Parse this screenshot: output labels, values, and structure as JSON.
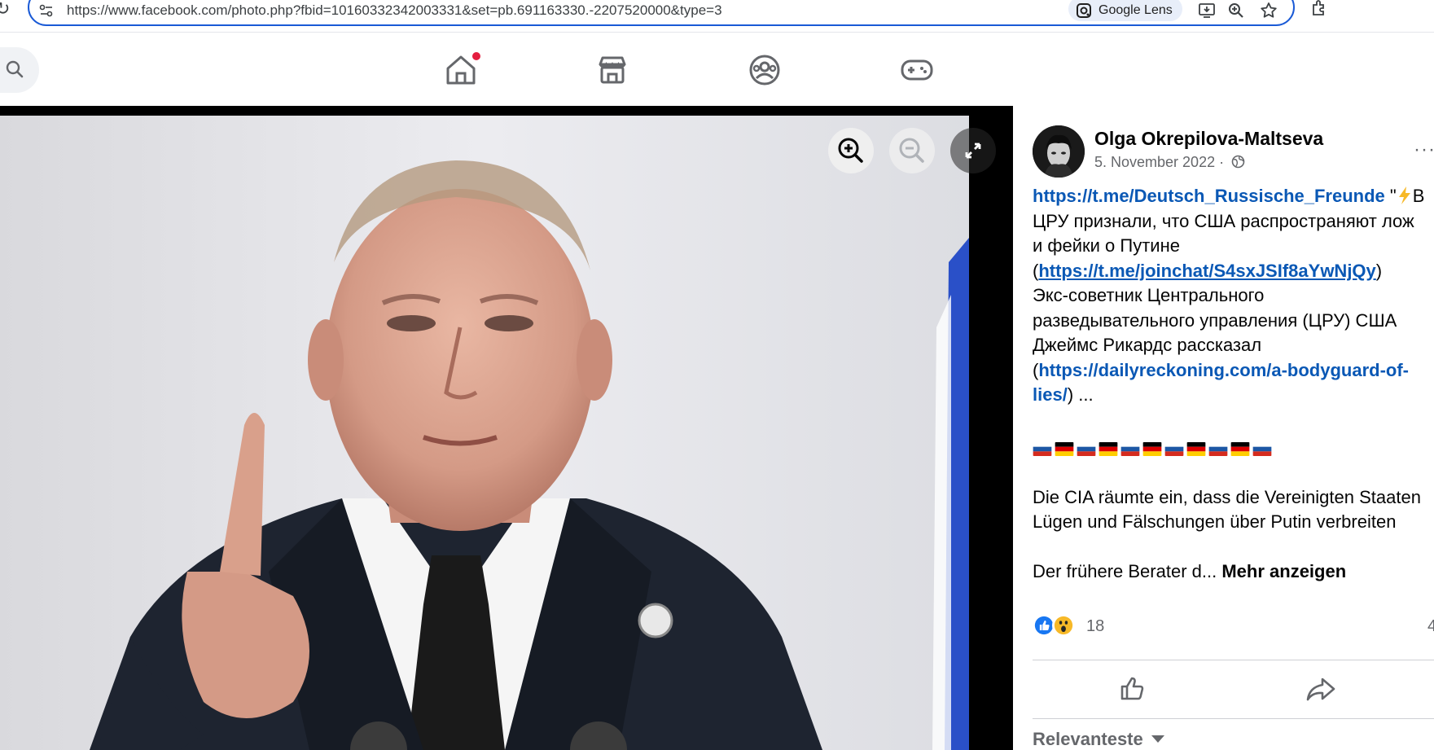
{
  "browser": {
    "url": "https://www.facebook.com/photo.php?fbid=10160332342003331&set=pb.691163330.-2207520000&type=3",
    "lens_label": "Google Lens",
    "icons": [
      "reload-icon",
      "site-info-icon",
      "google-lens-icon",
      "install-app-icon",
      "zoom-icon",
      "bookmark-star-icon",
      "extension-icon"
    ]
  },
  "fb_nav": {
    "icons": [
      "search-icon",
      "home-icon",
      "marketplace-icon",
      "groups-icon",
      "gaming-icon"
    ],
    "accent": "#1877f2",
    "notification_dot_color": "#e41e3f"
  },
  "viewer": {
    "controls": [
      "zoom-in-icon",
      "zoom-out-icon",
      "fullscreen-icon"
    ]
  },
  "post": {
    "author": "Olga Okrepilova-Maltseva",
    "date": "5. November 2022",
    "date_separator": " · ",
    "privacy_icon": "globe-icon",
    "more_label": "···",
    "body": {
      "link1": "https://t.me/Deutsch_Russische_Freunde",
      "quote_open": " \"",
      "ru_1a": "В",
      "ru_2": "ЦРУ признали, что США распространяют лож",
      "ru_3": "и фейки о Путине",
      "paren_open": "(",
      "link2": "https://t.me/joinchat/S4sxJSIf8aYwNjQy",
      "paren_close": ")",
      "ru_5": "Экс-советник Центрального",
      "ru_6": "разведывательного управления (ЦРУ) США",
      "ru_7": "Джеймс Рикардс рассказал",
      "link3_part1": "https://dailyreckoning.com/a-bodyguard-of-",
      "link3_part2": "lies/",
      "ellipsis": ") ...",
      "flags": [
        "ru",
        "de",
        "ru",
        "de",
        "ru",
        "de",
        "ru",
        "de",
        "ru",
        "de",
        "ru"
      ],
      "de_1": "Die CIA räumte ein, dass die Vereinigten Staaten",
      "de_2": "Lügen und Fälschungen über Putin verbreiten",
      "de_3": "Der frühere Berater d...",
      "see_more": "Mehr anzeigen"
    },
    "reactions": {
      "icons": [
        "like-reaction-icon",
        "wow-reaction-icon"
      ],
      "count": "18",
      "comments": "4"
    },
    "actions": [
      "like-icon",
      "share-icon"
    ],
    "sort_label": "Relevanteste"
  }
}
